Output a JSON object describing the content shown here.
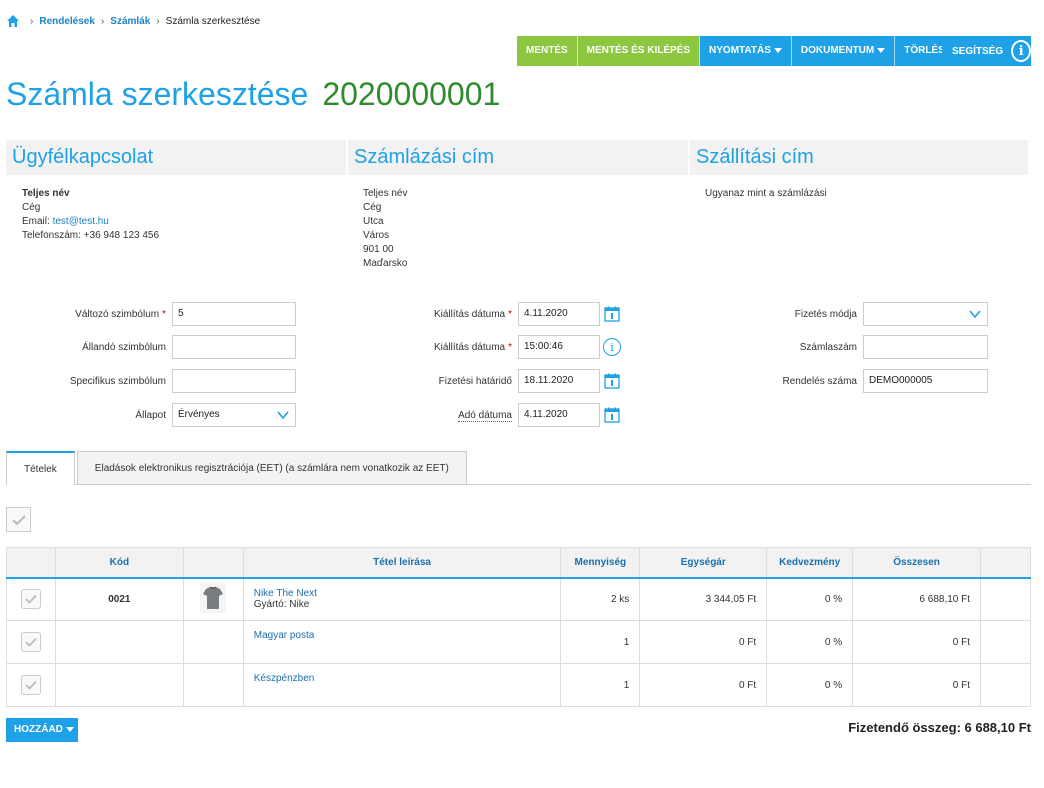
{
  "breadcrumb": {
    "items": [
      "Rendelések",
      "Számlák"
    ],
    "current": "Számla szerkesztése"
  },
  "toolbar": {
    "save": "MENTÉS",
    "save_exit": "MENTÉS ÉS KILÉPÉS",
    "print": "NYOMTATÁS",
    "document": "DOKUMENTUM",
    "delete": "TÖRLÉS",
    "help": "SEGÍTSÉG"
  },
  "colors": {
    "accent": "#1ea1e6",
    "green": "#8dc63f",
    "total_green": "#2e8b2e"
  },
  "page": {
    "title": "Számla szerkesztése",
    "number": "2020000001"
  },
  "contact": {
    "header": "Ügyfélkapcsolat",
    "name": "Teljes név",
    "company": "Cég",
    "email_label": "Email:",
    "email": "test@test.hu",
    "phone": "Telefonszám: +36 948 123 456"
  },
  "billing": {
    "header": "Számlázási cím",
    "lines": [
      "Teljes név",
      "Cég",
      "Utca",
      "Város",
      "901 00",
      "Maďarsko"
    ]
  },
  "shipping": {
    "header": "Szállítási cím",
    "text": "Ugyanaz mint a számlázási"
  },
  "form": {
    "variable_symbol": {
      "label": "Változó szimbólum",
      "value": "5"
    },
    "constant_symbol": {
      "label": "Állandó szimbólum",
      "value": ""
    },
    "specific_symbol": {
      "label": "Specifikus szimbólum",
      "value": ""
    },
    "status": {
      "label": "Állapot",
      "value": "Érvényes"
    },
    "issue_date": {
      "label": "Kiállítás dátuma",
      "value": "4.11.2020"
    },
    "issue_time": {
      "label": "Kiállítás dátuma",
      "value": "15:00:46"
    },
    "due_date": {
      "label": "Fizetési határidő",
      "value": "18.11.2020"
    },
    "tax_date": {
      "label": "Adó dátuma",
      "value": "4.11.2020"
    },
    "payment_method": {
      "label": "Fizetés módja",
      "value": ""
    },
    "account_number": {
      "label": "Számlaszám",
      "value": ""
    },
    "order_number": {
      "label": "Rendelés száma",
      "value": "DEMO000005"
    }
  },
  "tabs": [
    {
      "label": "Tételek"
    },
    {
      "label": "Eladások elektronikus regisztrációja (EET) (a számlára nem vonatkozik az EET)"
    }
  ],
  "table": {
    "headers": {
      "code": "Kód",
      "desc": "Tétel leírása",
      "qty": "Mennyiség",
      "unit": "Egységár",
      "discount": "Kedvezmény",
      "total": "Összesen"
    },
    "rows": [
      {
        "code": "0021",
        "name": "Nike The Next",
        "maker": "Gyártó: Nike",
        "qty": "2 ks",
        "unit": "3 344,05 Ft",
        "discount": "0 %",
        "total": "6 688,10 Ft",
        "has_image": true
      },
      {
        "code": "",
        "name": "Magyar posta",
        "maker": "",
        "qty": "1",
        "unit": "0 Ft",
        "discount": "0 %",
        "total": "0 Ft",
        "has_image": false
      },
      {
        "code": "",
        "name": "Készpénzben",
        "maker": "",
        "qty": "1",
        "unit": "0 Ft",
        "discount": "0 %",
        "total": "0 Ft",
        "has_image": false
      }
    ]
  },
  "footer": {
    "add_button": "HOZZÁAD",
    "grand_total": "Fizetendő összeg: 6 688,10 Ft"
  }
}
